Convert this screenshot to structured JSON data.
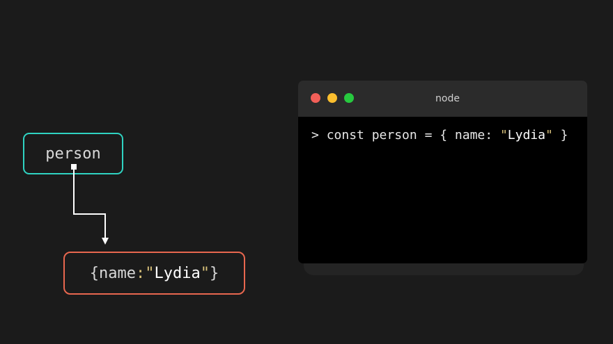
{
  "diagram": {
    "variable": {
      "name": "person"
    },
    "object": {
      "open_brace": "{",
      "key": "name",
      "colon": ":",
      "quote_open": "\"",
      "value": "Lydia",
      "quote_close": "\"",
      "close_brace": "}"
    },
    "colors": {
      "variable_border": "#2fd3c2",
      "object_border": "#e8674f",
      "string_quote": "#d8c17a",
      "background": "#1b1b1b"
    }
  },
  "terminal": {
    "title": "node",
    "buttons": {
      "close": "red-dot",
      "minimize": "yellow-dot",
      "maximize": "green-dot"
    },
    "line": {
      "prompt": ">",
      "code_before": "const person = { name: ",
      "quote_open": "\"",
      "value": "Lydia",
      "quote_close": "\"",
      "code_after": " }"
    }
  }
}
